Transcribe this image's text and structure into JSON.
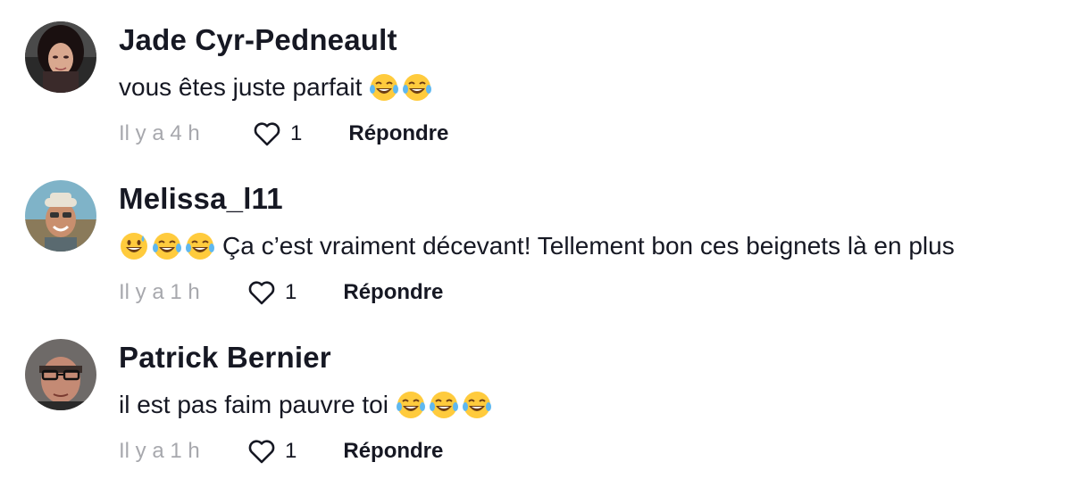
{
  "comments": [
    {
      "username": "Jade Cyr-Pedneault",
      "text": "vous êtes juste parfait",
      "time": "Il y a 4 h",
      "likes": "1",
      "reply_label": "Répondre"
    },
    {
      "username": "Melissa_l11",
      "text": "Ça c’est vraiment décevant! Tellement bon ces beignets là en plus",
      "time": "Il y a 1 h",
      "likes": "1",
      "reply_label": "Répondre"
    },
    {
      "username": "Patrick Bernier",
      "text": "il est pas faim pauvre toi",
      "time": "Il y a 1 h",
      "likes": "1",
      "reply_label": "Répondre"
    }
  ],
  "icons": {
    "like": "heart-outline-icon",
    "emoji": "face-with-tears-of-joy-emoji"
  },
  "colors": {
    "text": "#161823",
    "muted": "#a7a8ad",
    "background": "#ffffff"
  }
}
